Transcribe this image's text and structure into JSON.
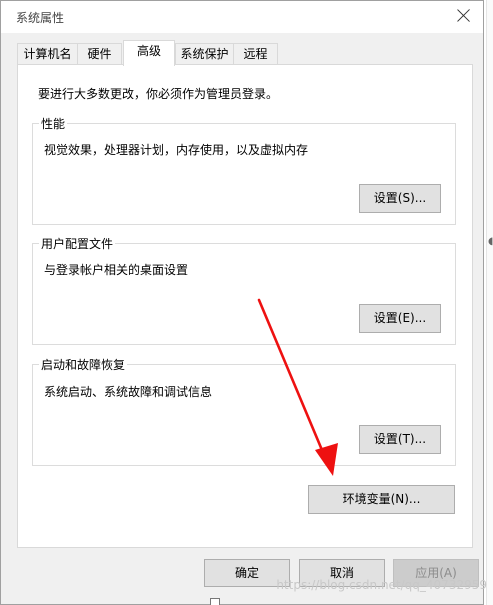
{
  "window": {
    "title": "系统属性"
  },
  "tabs": [
    {
      "label": "计算机名",
      "active": false
    },
    {
      "label": "硬件",
      "active": false
    },
    {
      "label": "高级",
      "active": true
    },
    {
      "label": "系统保护",
      "active": false
    },
    {
      "label": "远程",
      "active": false
    }
  ],
  "advanced": {
    "intro": "要进行大多数更改，你必须作为管理员登录。",
    "performance": {
      "title": "性能",
      "description": "视觉效果，处理器计划，内存使用，以及虚拟内存",
      "button": "设置(S)..."
    },
    "user_profiles": {
      "title": "用户配置文件",
      "description": "与登录帐户相关的桌面设置",
      "button": "设置(E)..."
    },
    "startup_recovery": {
      "title": "启动和故障恢复",
      "description": "系统启动、系统故障和调试信息",
      "button": "设置(T)..."
    },
    "env_button": "环境变量(N)..."
  },
  "footer": {
    "ok": "确定",
    "cancel": "取消",
    "apply": "应用(A)"
  },
  "watermark": "https://blog.csdn.net/qq_40732959",
  "colors": {
    "annotation_arrow": "#ee1111",
    "window_bg": "#f0f0f0",
    "button_bg": "#e1e1e1"
  }
}
